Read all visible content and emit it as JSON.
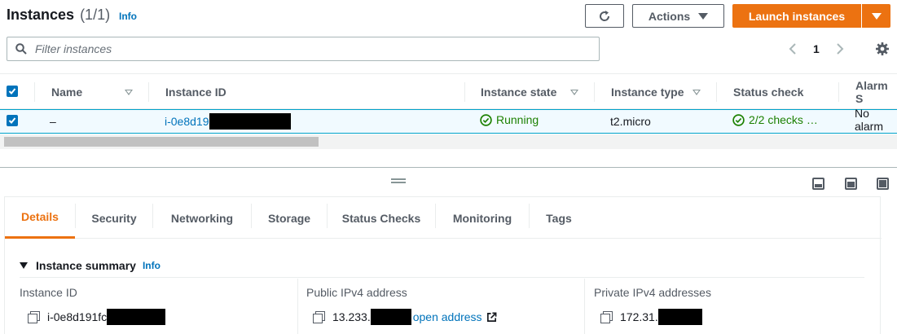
{
  "header": {
    "title": "Instances",
    "count": "(1/1)",
    "info": "Info",
    "actions_label": "Actions",
    "launch_label": "Launch instances"
  },
  "filter": {
    "placeholder": "Filter instances"
  },
  "pagination": {
    "current_page": "1"
  },
  "table": {
    "columns": [
      "Name",
      "Instance ID",
      "Instance state",
      "Instance type",
      "Status check",
      "Alarm S"
    ],
    "rows": [
      {
        "name": "–",
        "instance_id": "i-0e8d19",
        "state": "Running",
        "type": "t2.micro",
        "status_check": "2/2 checks …",
        "alarm": "No alarm"
      }
    ]
  },
  "tabs": [
    "Details",
    "Security",
    "Networking",
    "Storage",
    "Status Checks",
    "Monitoring",
    "Tags"
  ],
  "summary": {
    "title": "Instance summary",
    "info": "Info",
    "fields": [
      {
        "label": "Instance ID",
        "value": "i-0e8d191fc"
      },
      {
        "label": "Public IPv4 address",
        "value": "13.233.",
        "link": "open address"
      },
      {
        "label": "Private IPv4 addresses",
        "value": "172.31."
      }
    ]
  },
  "colors": {
    "accent": "#ec7211",
    "link": "#0073bb",
    "success": "#1d8102",
    "selected_row": "#f1faff"
  }
}
